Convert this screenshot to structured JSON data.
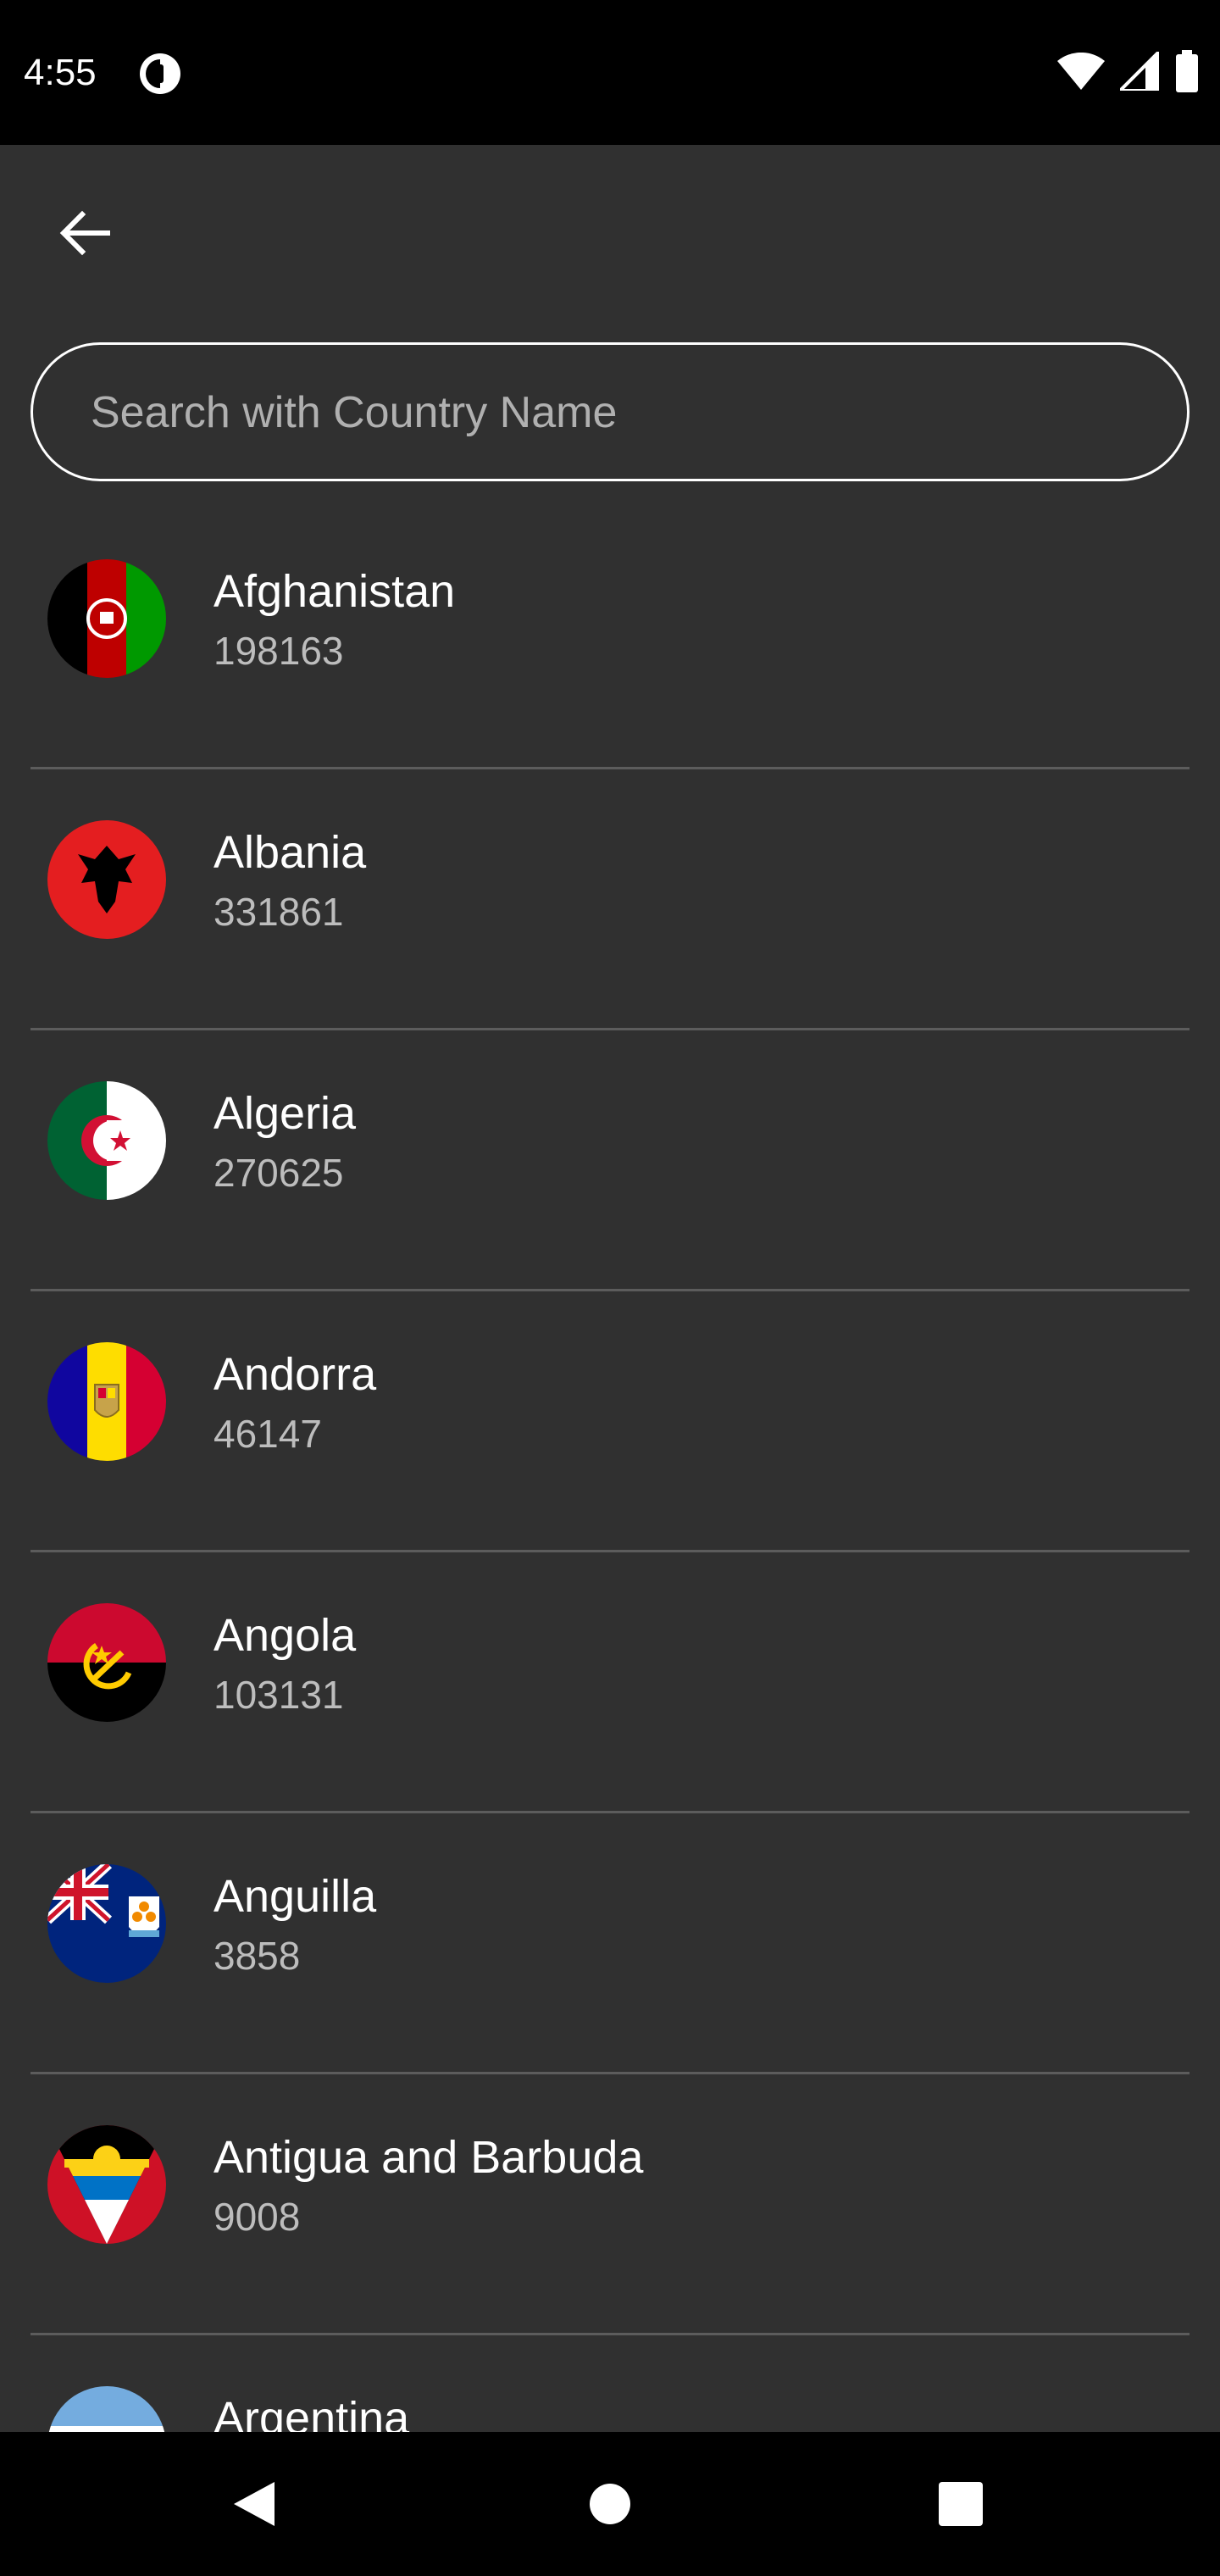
{
  "status_bar": {
    "time": "4:55"
  },
  "search": {
    "placeholder": "Search with Country Name",
    "value": ""
  },
  "countries": [
    {
      "name": "Afghanistan",
      "value": "198163",
      "flag": "afghanistan-flag-icon"
    },
    {
      "name": "Albania",
      "value": "331861",
      "flag": "albania-flag-icon"
    },
    {
      "name": "Algeria",
      "value": "270625",
      "flag": "algeria-flag-icon"
    },
    {
      "name": "Andorra",
      "value": "46147",
      "flag": "andorra-flag-icon"
    },
    {
      "name": "Angola",
      "value": "103131",
      "flag": "angola-flag-icon"
    },
    {
      "name": "Anguilla",
      "value": "3858",
      "flag": "anguilla-flag-icon"
    },
    {
      "name": "Antigua and Barbuda",
      "value": "9008",
      "flag": "antigua-and-barbuda-flag-icon"
    },
    {
      "name": "Argentina",
      "value": "",
      "flag": "argentina-flag-icon"
    }
  ],
  "colors": {
    "background": "#303030",
    "bars": "#000000",
    "divider": "#5c5c5c",
    "secondary_text": "#bdbdbd"
  }
}
